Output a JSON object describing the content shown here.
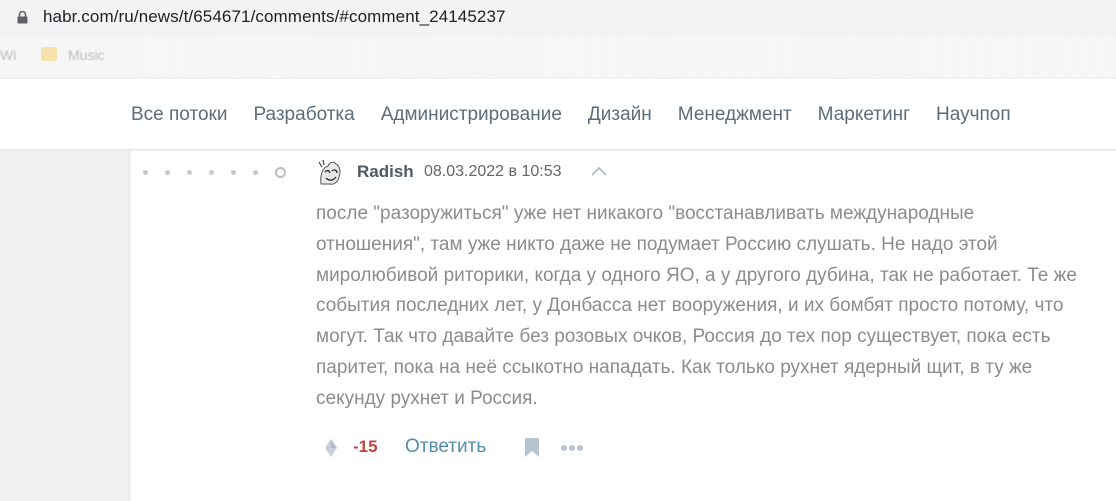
{
  "browser": {
    "url": "habr.com/ru/news/t/654671/comments/#comment_24145237",
    "bookmarks": [
      "Wi",
      "Music"
    ]
  },
  "nav": {
    "items": [
      "Все потоки",
      "Разработка",
      "Администрирование",
      "Дизайн",
      "Менеджмент",
      "Маркетинг",
      "Научпоп"
    ]
  },
  "comment": {
    "author": "Radish",
    "date": "08.03.2022 в 10:53",
    "text": "после \"разоружиться\" уже нет никакого \"восстанавливать международные отношения\", там уже никто даже не подумает Россию слушать. Не надо этой миролюбивой риторики, когда у одного ЯО, а у другого дубина, так не работает. Те же события последних лет, у Донбасса нет вооружения, и их бомбят просто потому, что могут. Так что давайте без розовых очков, Россия до тех пор существует, пока есть паритет, пока на неё ссыкотно нападать. Как только рухнет ядерный щит, в ту же секунду рухнет и Россия.",
    "score": "-15",
    "reply_label": "Ответить"
  },
  "colors": {
    "score_negative": "#c0453e",
    "link": "#548eaa",
    "nav_text": "#5e6d7a",
    "comment_text": "#8c8c8c"
  },
  "icons": {
    "lock": "lock-icon",
    "avatar": "avatar",
    "collapse": "chevron-up-icon",
    "vote": "vote-icon",
    "bookmark": "bookmark-icon",
    "more": "more-icon"
  }
}
